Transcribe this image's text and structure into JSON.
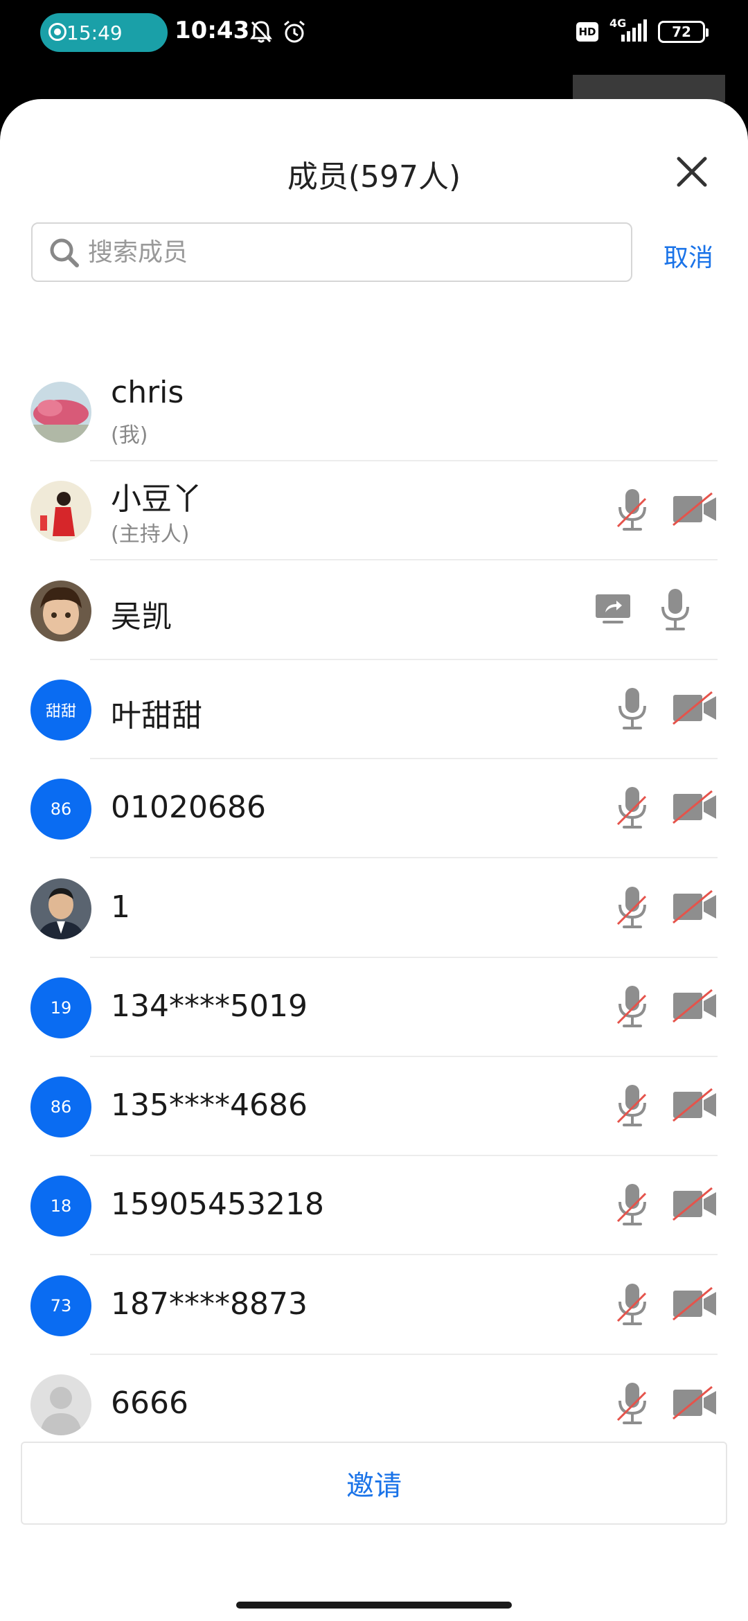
{
  "status_bar": {
    "record_time": "15:49",
    "clock": "10:43",
    "hd_label": "HD",
    "network_label": "4G",
    "battery": "72"
  },
  "sheet": {
    "title": "成员(597人)",
    "search_placeholder": "搜索成员",
    "cancel_label": "取消",
    "invite_label": "邀请"
  },
  "members": [
    {
      "name": "chris",
      "role": "(我)",
      "avatar_text": "",
      "avatar_type": "photo-landscape",
      "mic": "none",
      "cam": "none",
      "sharing": false
    },
    {
      "name": "小豆丫",
      "role": "(主持人)",
      "avatar_text": "",
      "avatar_type": "photo-person",
      "mic": "muted",
      "cam": "off",
      "sharing": false
    },
    {
      "name": "吴凯",
      "role": "",
      "avatar_text": "",
      "avatar_type": "photo-cartoon",
      "mic": "on",
      "cam": "none",
      "sharing": true
    },
    {
      "name": "叶甜甜",
      "role": "",
      "avatar_text": "甜甜",
      "avatar_type": "blue",
      "mic": "on",
      "cam": "off",
      "sharing": false
    },
    {
      "name": "01020686",
      "role": "",
      "avatar_text": "86",
      "avatar_type": "blue",
      "mic": "muted",
      "cam": "off",
      "sharing": false
    },
    {
      "name": "1",
      "role": "",
      "avatar_text": "",
      "avatar_type": "photo-man",
      "mic": "muted",
      "cam": "off",
      "sharing": false
    },
    {
      "name": "134****5019",
      "role": "",
      "avatar_text": "19",
      "avatar_type": "blue",
      "mic": "muted",
      "cam": "off",
      "sharing": false
    },
    {
      "name": "135****4686",
      "role": "",
      "avatar_text": "86",
      "avatar_type": "blue",
      "mic": "muted",
      "cam": "off",
      "sharing": false
    },
    {
      "name": "15905453218",
      "role": "",
      "avatar_text": "18",
      "avatar_type": "blue",
      "mic": "muted",
      "cam": "off",
      "sharing": false
    },
    {
      "name": "187****8873",
      "role": "",
      "avatar_text": "73",
      "avatar_type": "blue",
      "mic": "muted",
      "cam": "off",
      "sharing": false
    },
    {
      "name": "6666",
      "role": "",
      "avatar_text": "",
      "avatar_type": "default",
      "mic": "muted",
      "cam": "off",
      "sharing": false
    }
  ],
  "colors": {
    "accent": "#1a73e8",
    "avatar_blue": "#0a6cf2",
    "record_pill": "#1aa0a8",
    "muted_slash": "#e5534b",
    "icon_gray": "#8e8e8e"
  }
}
